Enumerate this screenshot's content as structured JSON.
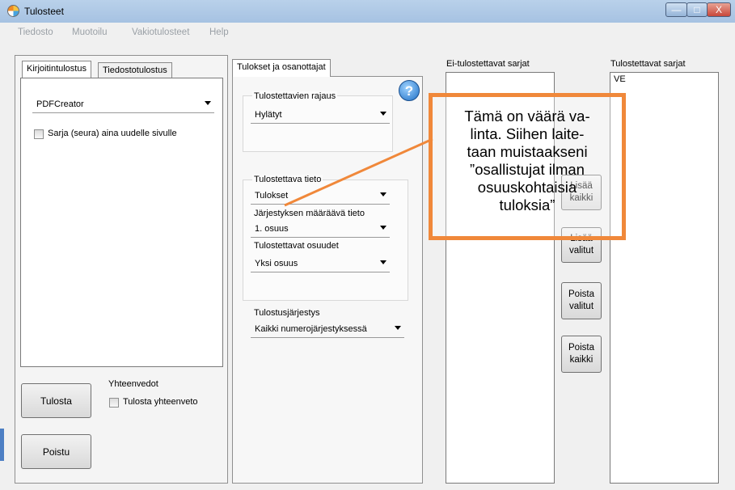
{
  "window": {
    "title": "Tulosteet",
    "min": "—",
    "max": "□",
    "close": "X"
  },
  "menu": {
    "items": [
      "Tiedosto",
      "Muotoilu",
      "Vakiotulosteet",
      "Help"
    ]
  },
  "left_panel": {
    "tabs": [
      "Kirjoitintulostus",
      "Tiedostotulostus"
    ],
    "printer": "PDFCreator",
    "series_checkbox": "Sarja (seura) aina uudelle sivulle",
    "summary_group": "Yhteenvedot",
    "summary_checkbox": "Tulosta yhteenveto",
    "print_button": "Tulosta",
    "exit_button": "Poistu"
  },
  "middle_panel": {
    "tab": "Tulokset ja osanottajat",
    "help": "?",
    "restriction_label": "Tulostettavien rajaus",
    "restriction_value": "Hylätyt",
    "printed_info_label": "Tulostettava tieto",
    "printed_info_value": "Tulokset",
    "order_info_label": "Järjestyksen määräävä tieto",
    "order_info_value": "1. osuus",
    "legs_label": "Tulostettavat osuudet",
    "legs_value": "Yksi osuus",
    "print_order_label": "Tulostusjärjestys",
    "print_order_value": "Kaikki numerojärjestyksessä"
  },
  "lists": {
    "non_printed_label": "Ei-tulostettavat sarjat",
    "printed_label": "Tulostettavat sarjat",
    "printed_items": [
      "VE"
    ]
  },
  "buttons": {
    "add_all": [
      "Lisää",
      "kaikki"
    ],
    "add_selected": [
      "Lisää",
      "valitut"
    ],
    "remove_selected": [
      "Poista",
      "valitut"
    ],
    "remove_all": [
      "Poista",
      "kaikki"
    ]
  },
  "callout": {
    "lines": [
      "Tämä on väärä va-",
      "linta. Siihen laite-",
      "taan muistaakseni",
      "”osallistujat ilman",
      "osuuskohtaisia",
      "tuloksia”"
    ],
    "color": "#f0883a"
  }
}
